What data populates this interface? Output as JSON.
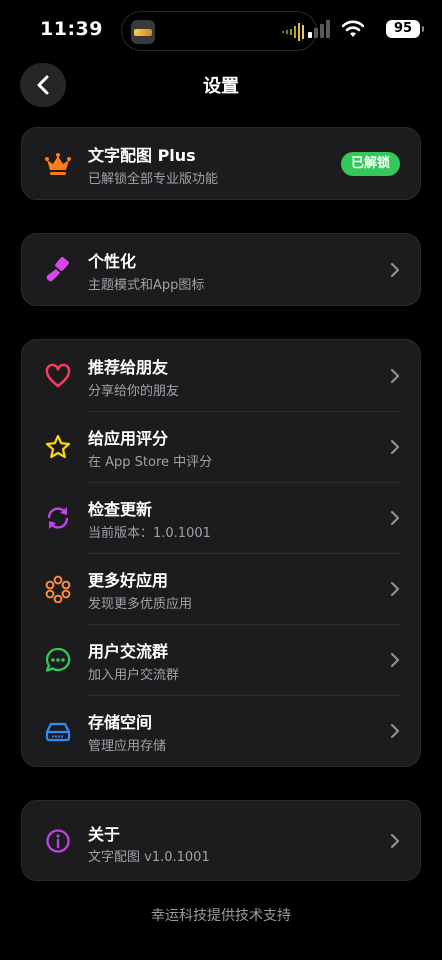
{
  "status": {
    "time": "11:39",
    "battery": "95"
  },
  "nav": {
    "title": "设置"
  },
  "plus": {
    "title": "文字配图 Plus",
    "subtitle": "已解锁全部专业版功能",
    "badge": "已解锁",
    "color": "#ff7a1a"
  },
  "personalize": {
    "title": "个性化",
    "subtitle": "主题模式和App图标",
    "icon": "paint-brush-icon",
    "color": "#d946ef"
  },
  "menu": [
    {
      "title": "推荐给朋友",
      "subtitle": "分享给你的朋友",
      "icon": "heart-icon",
      "color": "#ff3b5c"
    },
    {
      "title": "给应用评分",
      "subtitle": "在 App Store 中评分",
      "icon": "star-icon",
      "color": "#ffd60a"
    },
    {
      "title": "检查更新",
      "subtitle": "当前版本：1.0.1001",
      "icon": "refresh-icon",
      "color": "#c042e6"
    },
    {
      "title": "更多好应用",
      "subtitle": "发现更多优质应用",
      "icon": "apps-icon",
      "color": "#ff8a3d"
    },
    {
      "title": "用户交流群",
      "subtitle": "加入用户交流群",
      "icon": "chat-icon",
      "color": "#34c759"
    },
    {
      "title": "存储空间",
      "subtitle": "管理应用存储",
      "icon": "storage-icon",
      "color": "#2f8cff"
    }
  ],
  "about": {
    "title": "关于",
    "subtitle": "文字配图 v1.0.1001",
    "icon": "info-icon",
    "color": "#c042e6"
  },
  "footer": {
    "text": "幸运科技提供技术支持"
  }
}
